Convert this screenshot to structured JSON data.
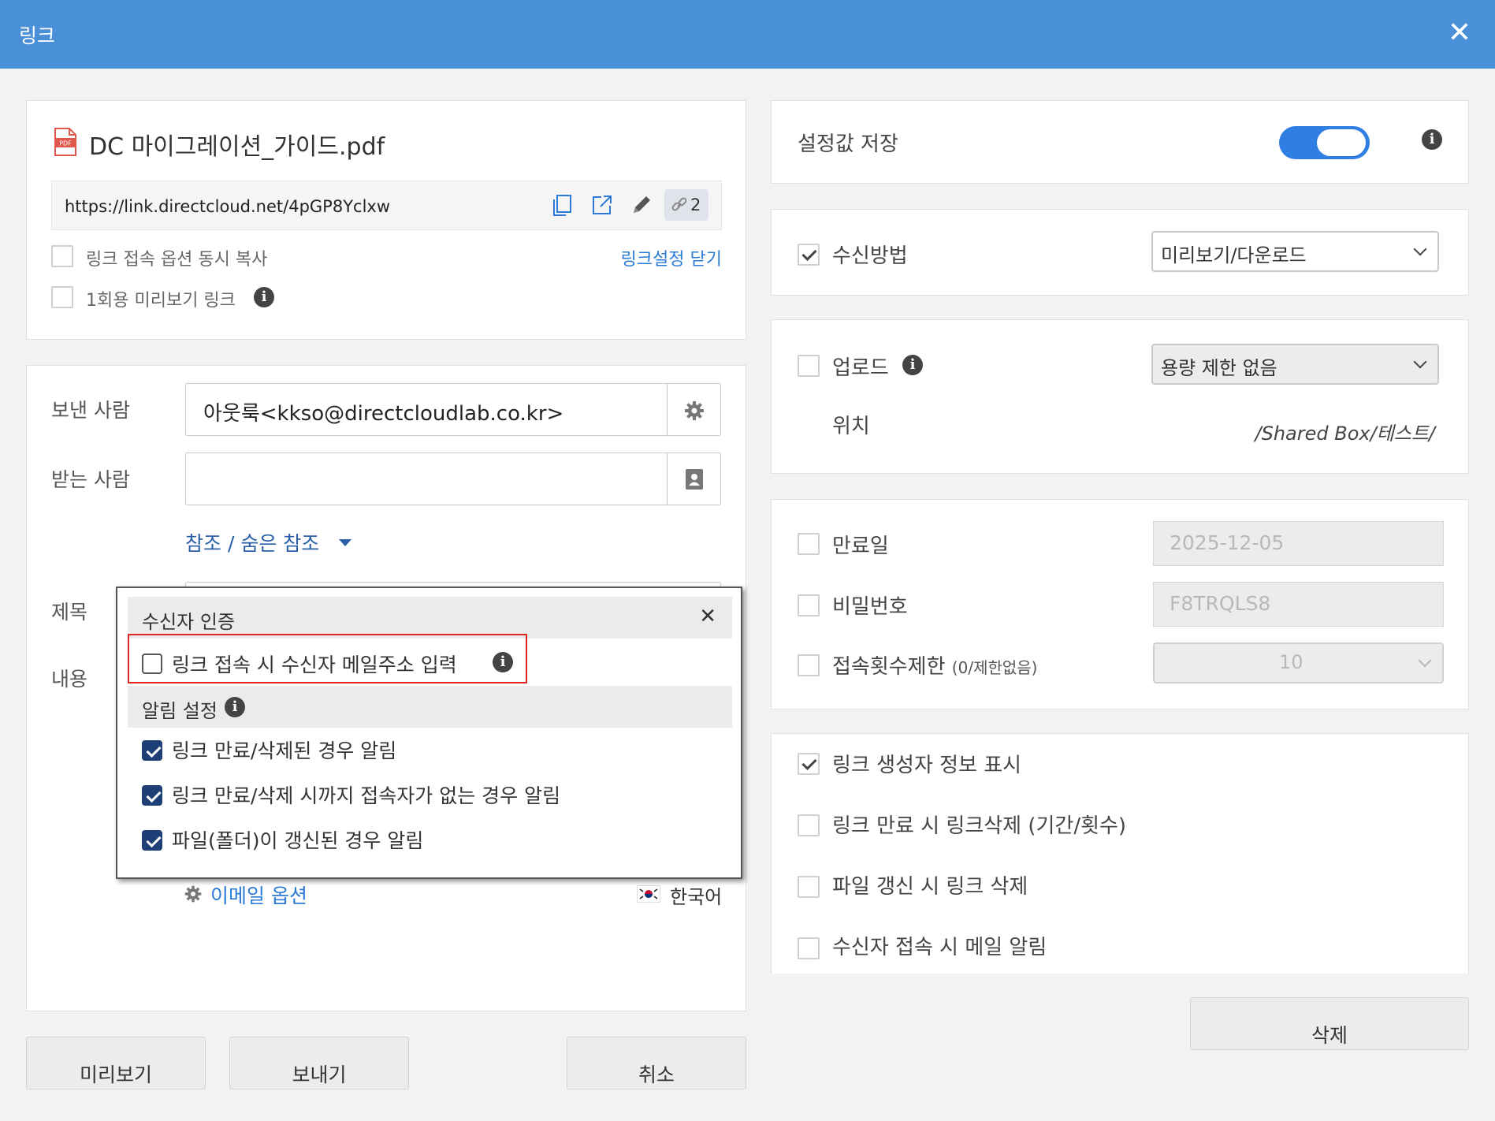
{
  "window": {
    "title": "링크",
    "close_icon": "close-icon"
  },
  "file": {
    "name": "DC 마이그레이션_가이드.pdf",
    "icon": "pdf-file-icon",
    "pdf_badge": "PDF",
    "url": "https://link.directcloud.net/4pGP8Yclxw",
    "link_count": "2"
  },
  "link_options": {
    "copy_with_options": "링크 접속 옵션 동시 복사",
    "close_settings": "링크설정 닫기",
    "one_time_preview": "1회용 미리보기 링크"
  },
  "email": {
    "sender_label": "보낸 사람",
    "sender_value": "아웃룩<kkso@directcloudlab.co.kr>",
    "recipient_label": "받는 사람",
    "recipient_value": "",
    "cc_bcc": "참조 / 숨은 참조",
    "subject_label": "제목",
    "body_label": "내용",
    "email_options": "이메일 옵션",
    "language": "한국어"
  },
  "popup": {
    "auth_header": "수신자 인증",
    "auth_option": "링크 접속 시 수신자 메일주소 입력",
    "auth_checked": false,
    "notify_header": "알림 설정",
    "notify_items": [
      {
        "label": "링크 만료/삭제된 경우 알림",
        "checked": true
      },
      {
        "label": "링크 만료/삭제 시까지 접속자가 없는 경우 알림",
        "checked": true
      },
      {
        "label": "파일(폴더)이 갱신된 경우 알림",
        "checked": true
      }
    ]
  },
  "buttons": {
    "preview": "미리보기",
    "send": "보내기",
    "cancel": "취소",
    "delete": "삭제"
  },
  "settings": {
    "save_label": "설정값 저장",
    "save_on": true,
    "receive_method_label": "수신방법",
    "receive_method_checked": true,
    "receive_method_value": "미리보기/다운로드",
    "upload_label": "업로드",
    "upload_checked": false,
    "upload_value": "용량 제한 없음",
    "location_label": "위치",
    "location_value": "/Shared Box/테스트/",
    "expiry_label": "만료일",
    "expiry_value": "2025-12-05",
    "password_label": "비밀번호",
    "password_value": "F8TRQLS8",
    "access_limit_label": "접속횟수제한",
    "access_limit_hint": "(0/제한없음)",
    "access_limit_value": "10",
    "show_creator_label": "링크 생성자 정보 표시",
    "show_creator_checked": true,
    "delete_on_expiry_label": "링크 만료 시 링크삭제 (기간/횟수)",
    "delete_on_update_label": "파일 갱신 시 링크 삭제",
    "notify_on_access_label": "수신자 접속 시 메일 알림"
  },
  "colors": {
    "titlebar": "#4a90d9",
    "link": "#2b7bd6",
    "toggle": "#2f7ee3",
    "highlight": "#e02424",
    "checkbox_fill": "#1e3f75"
  }
}
